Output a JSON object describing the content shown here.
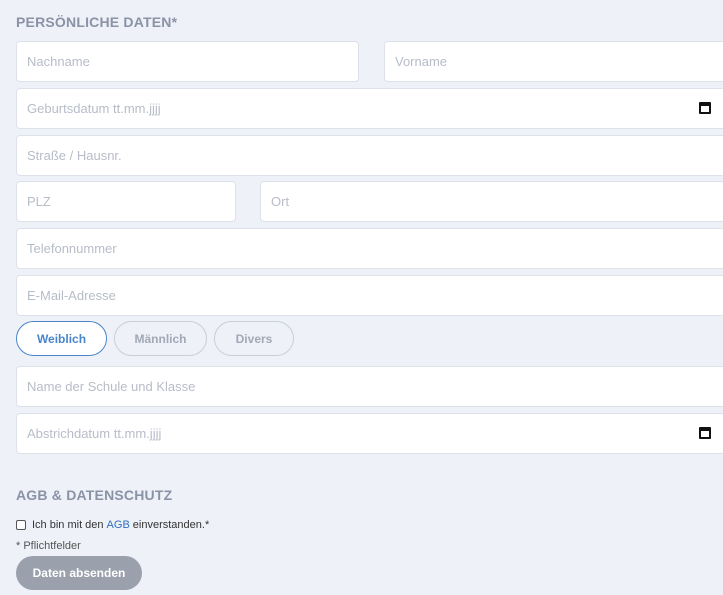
{
  "personal": {
    "title": "PERSÖNLICHE DATEN*",
    "nachname_placeholder": "Nachname",
    "vorname_placeholder": "Vorname",
    "geburtsdatum_placeholder": "Geburtsdatum tt.mm.jjjj",
    "strasse_placeholder": "Straße / Hausnr.",
    "plz_placeholder": "PLZ",
    "ort_placeholder": "Ort",
    "telefon_placeholder": "Telefonnummer",
    "email_placeholder": "E-Mail-Adresse",
    "gender_options": [
      "Weiblich",
      "Männlich",
      "Divers"
    ],
    "gender_selected": "Weiblich",
    "schule_placeholder": "Name der Schule und Klasse",
    "abstrich_placeholder": "Abstrichdatum tt.mm.jjjj",
    "calendar_icon": "calendar-icon"
  },
  "agb": {
    "title": "AGB & DATENSCHUTZ",
    "checkbox_before": "Ich bin mit den",
    "checkbox_link": "AGB",
    "checkbox_after": "einverstanden.*",
    "checked": false
  },
  "required_note": "* Pflichtfelder",
  "submit_label": "Daten absenden",
  "colors": {
    "background": "#eef1f8",
    "accent": "#4a84c9",
    "link": "#2f6fba",
    "button": "#9aa1ad"
  }
}
